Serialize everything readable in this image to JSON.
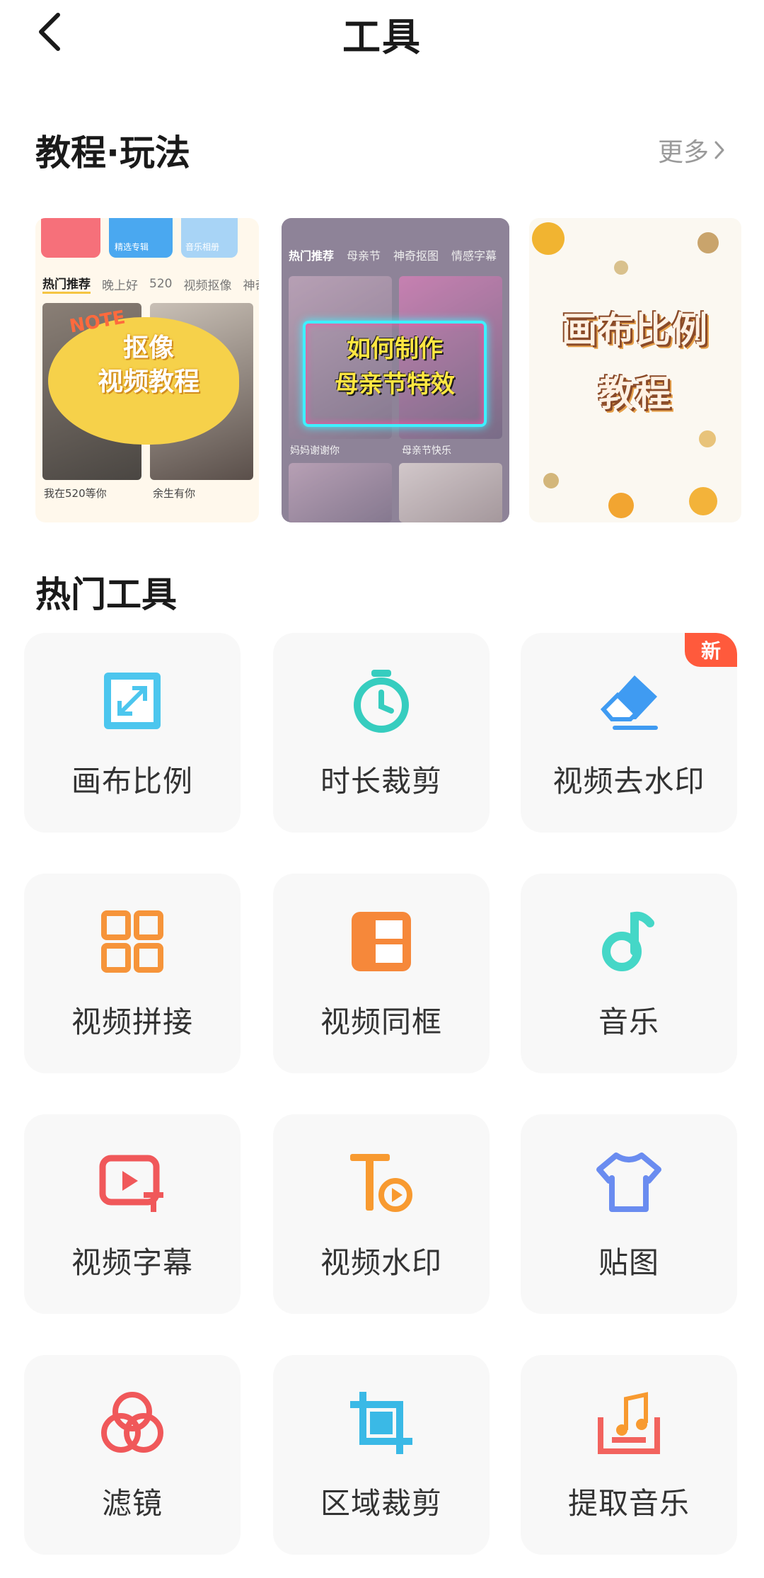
{
  "header": {
    "title": "工具"
  },
  "tutorials": {
    "heading": "教程·玩法",
    "more_label": "更多",
    "cards": [
      {
        "tabs": [
          "热门推荐",
          "晚上好",
          "520",
          "视频抠像",
          "神奇"
        ],
        "pill_labels": [
          "精选专辑",
          "音乐相册"
        ],
        "tag": "NOTE",
        "title_lines": [
          "抠像",
          "视频教程"
        ],
        "captions": [
          "我在520等你",
          "余生有你"
        ]
      },
      {
        "tabs": [
          "热门推荐",
          "母亲节",
          "神奇抠图",
          "情感字幕"
        ],
        "title_lines": [
          "如何制作",
          "母亲节特效"
        ],
        "captions": [
          "妈妈谢谢你",
          "母亲节快乐"
        ]
      },
      {
        "title_lines": [
          "画布比例",
          "教程"
        ]
      }
    ]
  },
  "tools": {
    "heading": "热门工具",
    "new_badge": "新",
    "items": [
      {
        "label": "画布比例",
        "icon": "canvas-ratio-icon",
        "color": "#4cc6ee"
      },
      {
        "label": "时长裁剪",
        "icon": "duration-trim-icon",
        "color": "#36cdbf"
      },
      {
        "label": "视频去水印",
        "icon": "eraser-icon",
        "color": "#3f9bf2"
      },
      {
        "label": "视频拼接",
        "icon": "grid-splice-icon",
        "color": "#f6943a"
      },
      {
        "label": "视频同框",
        "icon": "same-frame-icon",
        "color": "#f6883a"
      },
      {
        "label": "音乐",
        "icon": "music-note-icon",
        "color": "#45d7c7"
      },
      {
        "label": "视频字幕",
        "icon": "subtitle-icon",
        "color": "#f0585a"
      },
      {
        "label": "视频水印",
        "icon": "text-watermark-icon",
        "color": "#f89a30"
      },
      {
        "label": "贴图",
        "icon": "sticker-shirt-icon",
        "color": "#6a8cf0"
      },
      {
        "label": "滤镜",
        "icon": "filter-circles-icon",
        "color": "#f0585a"
      },
      {
        "label": "区域裁剪",
        "icon": "crop-icon",
        "color": "#3ab9e6"
      },
      {
        "label": "提取音乐",
        "icon": "extract-music-icon",
        "color": "#f2635e"
      }
    ]
  }
}
